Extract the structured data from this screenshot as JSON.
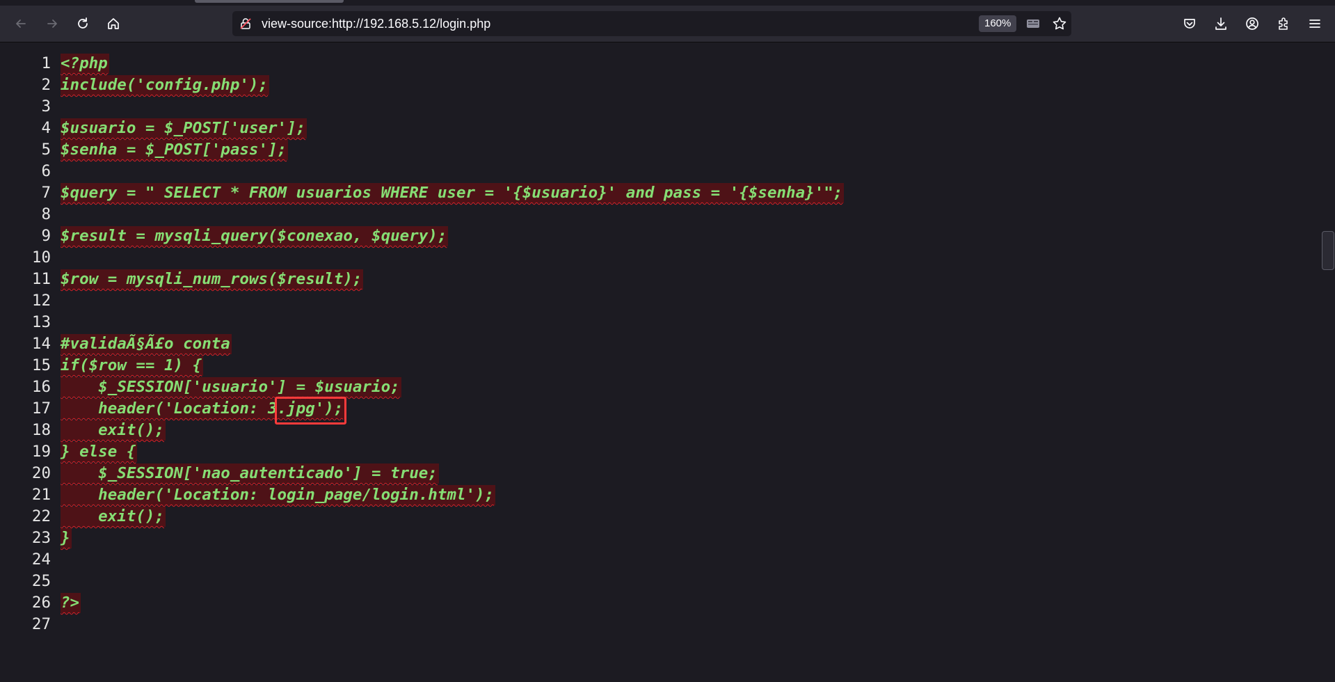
{
  "browser": {
    "url": "view-source:http://192.168.5.12/login.php",
    "zoom": "160%"
  },
  "icons": {
    "back": "back-arrow-icon",
    "forward": "forward-arrow-icon",
    "reload": "reload-icon",
    "home": "home-icon",
    "site": "insecure-lock-icon",
    "reader": "reader-view-icon",
    "bookmark": "bookmark-star-icon",
    "pocket": "pocket-icon",
    "downloads": "download-icon",
    "account": "account-icon",
    "extensions": "extensions-icon",
    "menu": "hamburger-menu-icon"
  },
  "colors": {
    "code_text": "#86de74",
    "error_highlight": "#c40000",
    "annotation_box": "#ff3b3b"
  },
  "source": {
    "lines": [
      {
        "n": "1",
        "text": "<?php"
      },
      {
        "n": "2",
        "text": "include('config.php');"
      },
      {
        "n": "3",
        "text": ""
      },
      {
        "n": "4",
        "text": "$usuario = $_POST['user'];"
      },
      {
        "n": "5",
        "text": "$senha = $_POST['pass'];"
      },
      {
        "n": "6",
        "text": ""
      },
      {
        "n": "7",
        "text": "$query = \" SELECT * FROM usuarios WHERE user = '{$usuario}' and pass = '{$senha}'\";"
      },
      {
        "n": "8",
        "text": ""
      },
      {
        "n": "9",
        "text": "$result = mysqli_query($conexao, $query);"
      },
      {
        "n": "10",
        "text": ""
      },
      {
        "n": "11",
        "text": "$row = mysqli_num_rows($result);"
      },
      {
        "n": "12",
        "text": ""
      },
      {
        "n": "13",
        "text": ""
      },
      {
        "n": "14",
        "text": "#validaÃ§Ã£o conta"
      },
      {
        "n": "15",
        "text": "if($row == 1) {"
      },
      {
        "n": "16",
        "text": "    $_SESSION['usuario'] = $usuario;"
      },
      {
        "n": "17",
        "text": "    header('Location: 3.jpg');"
      },
      {
        "n": "18",
        "text": "    exit();"
      },
      {
        "n": "19",
        "text": "} else {"
      },
      {
        "n": "20",
        "text": "    $_SESSION['nao_autenticado'] = true;"
      },
      {
        "n": "21",
        "text": "    header('Location: login_page/login.html');"
      },
      {
        "n": "22",
        "text": "    exit();"
      },
      {
        "n": "23",
        "text": "}"
      },
      {
        "n": "24",
        "text": ""
      },
      {
        "n": "25",
        "text": ""
      },
      {
        "n": "26",
        "text": "?>"
      },
      {
        "n": "27",
        "text": ""
      }
    ],
    "highlighted_text": "3.jpg'"
  }
}
